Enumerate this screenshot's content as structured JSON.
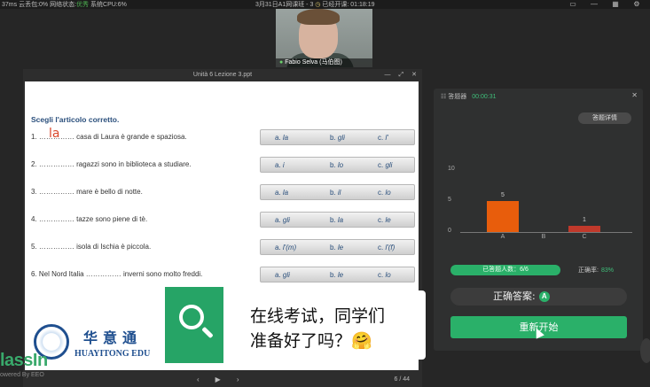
{
  "topbar": {
    "latency": "37ms",
    "cloud_label": "云丢包:",
    "cloud_val": "0%",
    "net_label": "网络状态:",
    "net_val": "优秀",
    "cpu_label": "系统CPU:",
    "cpu_val": "6%",
    "class_title": "3月31日A1网课班 - 3",
    "class_start_label": "已经开课:",
    "class_elapsed": "01:18:19",
    "icons": [
      "window-icon",
      "minimize-icon",
      "grid-icon",
      "settings-icon"
    ]
  },
  "video": {
    "name": "Fabio Selva (马伯图)"
  },
  "ppt": {
    "title": "Unità 6 Lezione 3.ppt",
    "page": "6 / 44",
    "slide": {
      "header": "Scegli l'articolo corretto.",
      "ink": "la",
      "questions": [
        {
          "text": "1. …………… casa di Laura è grande e spaziosa.",
          "a": "la",
          "b": "gli",
          "c": "l'"
        },
        {
          "text": "2. …………… ragazzi sono in biblioteca a studiare.",
          "a": "i",
          "b": "lo",
          "c": "gli"
        },
        {
          "text": "3. …………… mare è bello di notte.",
          "a": "la",
          "b": "il",
          "c": "lo"
        },
        {
          "text": "4. …………… tazze sono piene di tè.",
          "a": "gli",
          "b": "la",
          "c": "le"
        },
        {
          "text": "5. …………… isola di Ischia è piccola.",
          "a": "l'(m)",
          "b": "le",
          "c": "l'(f)"
        },
        {
          "text": "6. Nel Nord Italia …………… inverni sono molto freddi.",
          "a": "gli",
          "b": "le",
          "c": "lo"
        }
      ],
      "logo_cn": "华意通",
      "logo_en": "HUAYITONG EDU"
    }
  },
  "watermark": {
    "brand": "lassIn",
    "powered": "owered By EEO"
  },
  "overlay": {
    "line1": "在线考试，同学们",
    "line2": "准备好了吗？🤗"
  },
  "panel": {
    "title": "答题器",
    "timer": "00:00:31",
    "detail_button": "答题详情",
    "answered_label": "已答题人数：6/6",
    "answered_fraction": 1.0,
    "rate_label": "正确率:",
    "rate_value": "83%",
    "correct_label": "正确答案:",
    "correct_answer": "A",
    "restart_button": "重新开始",
    "colors": {
      "accent": "#2ab069",
      "bar_a": "#e85d0c",
      "bar_c": "#c0392b"
    }
  },
  "chart_data": {
    "type": "bar",
    "categories": [
      "A",
      "B",
      "C"
    ],
    "values": [
      5,
      0,
      1
    ],
    "ylim": [
      0,
      10
    ],
    "yticks": [
      0,
      5,
      10
    ]
  }
}
